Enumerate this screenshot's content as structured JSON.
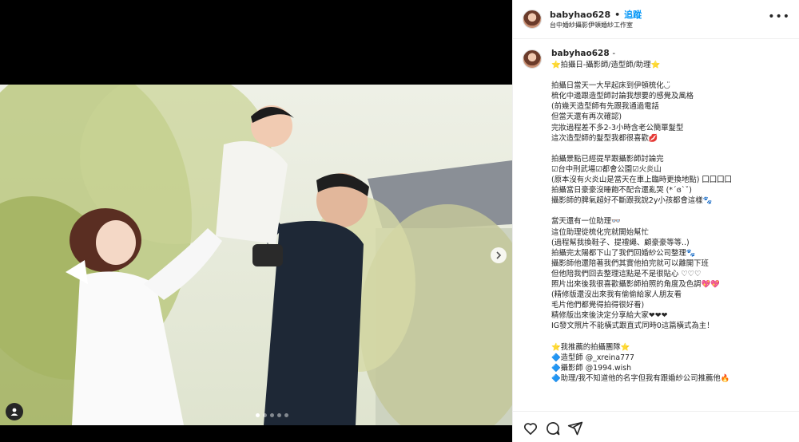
{
  "post": {
    "username": "babyhao628",
    "separator": "•",
    "follow_label": "追蹤",
    "location": "台中婚紗攝影伊頓婚紗工作室",
    "more_label": "•••"
  },
  "caption": {
    "username": "babyhao628",
    "dash": "-",
    "lines": [
      "⭐拍攝日-攝影師/造型師/助理⭐",
      "",
      "拍攝日當天一大早起床到伊頓梳化◡̈",
      "梳化中邊跟造型師討論我想要的感覺及風格",
      "(前幾天造型師有先跟我通過電話",
      "但當天還有再次確認)",
      "完妝過程差不多2-3小時含老公簡單髮型",
      "這次造型師的髮型我都很喜歡💋",
      "",
      "拍攝景點已經提早跟攝影師討論完",
      "☑台中刑武場☑都會公園☑火炎山",
      "(原本沒有火炎山是當天在車上臨時更換地點) 囗囗囗囗",
      "拍攝當日豪豪沒睡飽不配合還亂哭 (*´ɞ`ˇ)",
      "攝影師的脾氣超好不斷跟我說2y小孩都會這樣🐾",
      "",
      "當天還有一位助理👓",
      "這位助理從梳化完就開始幫忙",
      "(過程幫我換鞋子、提禮繩、顧豪豪等等..)",
      "拍攝完太陽都下山了我們回婚紗公司整理🐾",
      "攝影師他還陪著我們其實他拍完就可以離開下班",
      "但他陪我們回去整理這點是不是很貼心 ♡♡♡",
      "照片出來後我很喜歡攝影師拍照的角度及色調💖💖",
      "(精修版還沒出來我有偷偷給家人朋友看",
      "毛片他們都覺得拍得很好看)",
      "精修版出來後決定分享給大家❤❤❤",
      "IG發文照片不能橫式跟直式同時0這篇橫式為主！",
      "",
      "⭐我推薦的拍攝團隊⭐",
      "🔷造型師 @_xreina777",
      "🔷攝影師 @1994.wish",
      "🔷助理/我不知道他的名字但我有跟婚紗公司推薦他🔥"
    ]
  },
  "carousel": {
    "slide_count": 5,
    "active_index": 0
  },
  "icons": {
    "next": "chevron-right-icon",
    "tag": "user-tag-icon",
    "like": "heart-icon",
    "comment": "comment-icon",
    "share": "share-icon",
    "more": "more-icon"
  },
  "colors": {
    "link": "#00376b",
    "follow": "#0095f6",
    "text": "#262626",
    "border": "#efefef"
  }
}
